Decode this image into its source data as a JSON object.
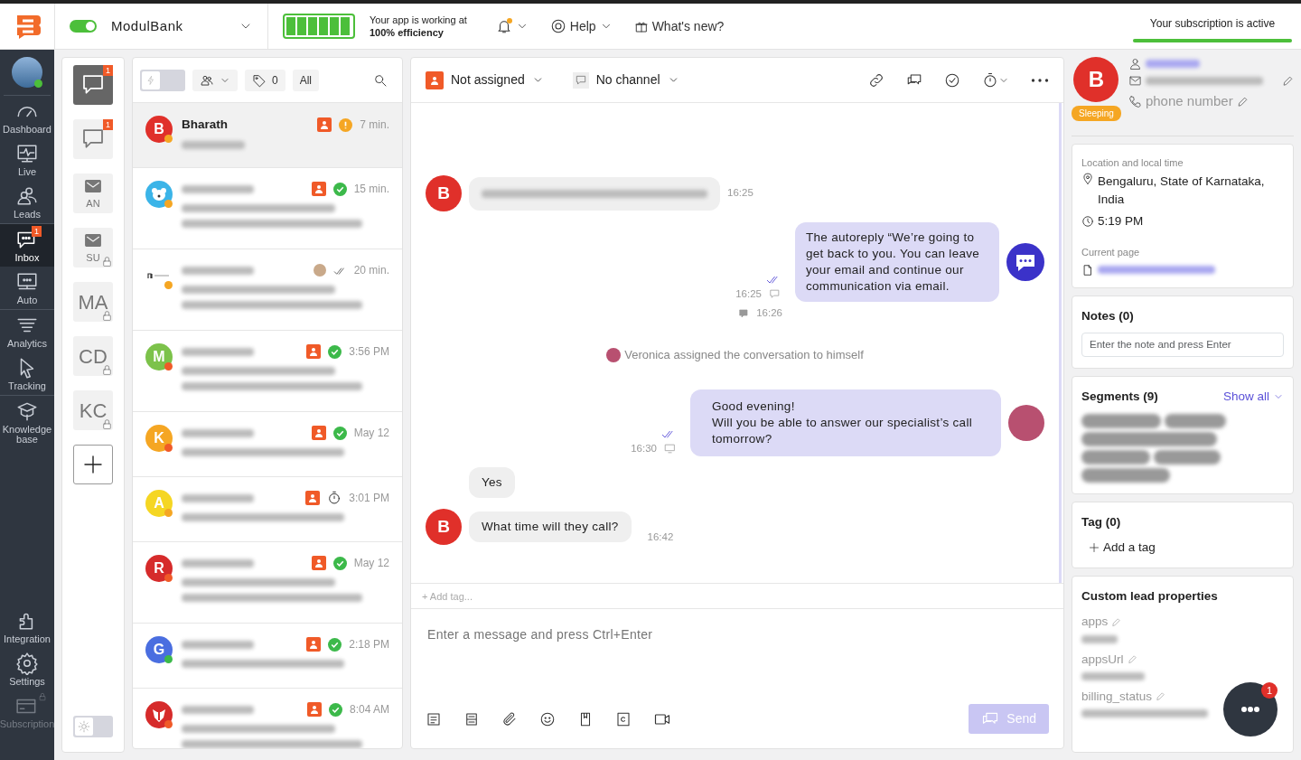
{
  "topbar": {
    "app_toggle_on": true,
    "project": "ModulBank",
    "battery": {
      "level": 1.0
    },
    "efficiency_line1": "Your app is working at",
    "efficiency_line2": "100% efficiency",
    "notifications_unread": true,
    "help": "Help",
    "whats_new": "What's new?",
    "subscription": {
      "text": "Your subscription is active",
      "level": 1.0
    }
  },
  "sidebar": {
    "items": [
      {
        "kind": "dashboard",
        "label": "Dashboard",
        "selected": false,
        "locked": false
      },
      {
        "kind": "live",
        "label": "Live",
        "selected": false,
        "locked": false
      },
      {
        "kind": "leads",
        "label": "Leads",
        "selected": false,
        "locked": false
      },
      {
        "kind": "inbox",
        "label": "Inbox",
        "selected": true,
        "badge": "1",
        "locked": false
      },
      {
        "kind": "auto",
        "label": "Auto",
        "selected": false,
        "locked": false
      },
      {
        "kind": "analytics",
        "label": "Analytics",
        "selected": false,
        "locked": false
      },
      {
        "kind": "tracking",
        "label": "Tracking",
        "selected": false,
        "locked": false
      },
      {
        "kind": "knowledge",
        "label": "Knowledge base",
        "selected": false,
        "locked": false
      },
      {
        "kind": "integration",
        "label": "Integration",
        "selected": false,
        "locked": false
      },
      {
        "kind": "settings",
        "label": "Settings",
        "selected": false,
        "locked": false
      },
      {
        "kind": "subscription",
        "label": "Subscription",
        "selected": false,
        "locked": true
      }
    ]
  },
  "channels": [
    {
      "kind": "chat",
      "selected": true,
      "badge": "1",
      "locked": false
    },
    {
      "kind": "chat",
      "selected": false,
      "badge": "1",
      "locked": false
    },
    {
      "kind": "mail",
      "label": "AN",
      "selected": false,
      "locked": false
    },
    {
      "kind": "mail",
      "label": "SU",
      "selected": false,
      "locked": true
    },
    {
      "kind": "text",
      "label": "MA",
      "selected": false,
      "locked": true
    },
    {
      "kind": "text",
      "label": "CD",
      "selected": false,
      "locked": true
    },
    {
      "kind": "text",
      "label": "KC",
      "selected": false,
      "locked": true
    }
  ],
  "theme_dark": false,
  "list_toolbar": {
    "auto_assign_on": false,
    "tag_count": "0",
    "filter": "All"
  },
  "conversations": [
    {
      "avatar": {
        "kind": "letter",
        "text": "B",
        "color": "#e0302a"
      },
      "dot": {
        "color": "#f5a623"
      },
      "status": {
        "kind": "pending"
      },
      "name": "Bharath",
      "time": "7 min.",
      "selected": true,
      "multiline_preview": false
    },
    {
      "avatar": {
        "kind": "bear",
        "color": "#3bb4e8"
      },
      "dot": {
        "color": "#f5a623"
      },
      "status": {
        "kind": "done"
      },
      "time": "15 min.",
      "selected": false,
      "multiline_preview": true
    },
    {
      "avatar": {
        "kind": "logo",
        "color": "#ffffff"
      },
      "dot": {
        "color": "#f5a623"
      },
      "status": {
        "kind": "read"
      },
      "time": "20 min.",
      "selected": false,
      "multiline_preview": true
    },
    {
      "avatar": {
        "kind": "letter",
        "text": "M",
        "color": "#7cc24a"
      },
      "dot": {
        "color": "#f05a28"
      },
      "status": {
        "kind": "done"
      },
      "time": "3:56 PM",
      "selected": false,
      "multiline_preview": true
    },
    {
      "avatar": {
        "kind": "letter",
        "text": "K",
        "color": "#f5a623"
      },
      "dot": {
        "color": "#f05a28"
      },
      "status": {
        "kind": "done"
      },
      "time": "May 12",
      "selected": false,
      "multiline_preview": false
    },
    {
      "avatar": {
        "kind": "letter",
        "text": "A",
        "color": "#f5d623"
      },
      "dot": {
        "color": "#f5a623"
      },
      "status": {
        "kind": "snoozed"
      },
      "time": "3:01 PM",
      "selected": false,
      "multiline_preview": false
    },
    {
      "avatar": {
        "kind": "letter",
        "text": "R",
        "color": "#d62b2b"
      },
      "dot": {
        "color": "#f05a28"
      },
      "status": {
        "kind": "done"
      },
      "time": "May 12",
      "selected": false,
      "multiline_preview": true
    },
    {
      "avatar": {
        "kind": "letter",
        "text": "G",
        "color": "#4a6ee0"
      },
      "dot": {
        "color": "#3cb94a"
      },
      "status": {
        "kind": "done"
      },
      "time": "2:18 PM",
      "selected": false,
      "multiline_preview": false
    },
    {
      "avatar": {
        "kind": "badger",
        "color": "#d62b2b"
      },
      "dot": {
        "color": "#f05a28"
      },
      "status": {
        "kind": "done"
      },
      "time": "8:04 AM",
      "selected": false,
      "multiline_preview": true
    }
  ],
  "chat_header": {
    "assignee": "Not assigned",
    "channel": "No channel"
  },
  "messages": [
    {
      "kind": "incoming",
      "avatar": "B",
      "time": "16:25"
    },
    {
      "kind": "outgoing",
      "text": "The autoreply “We’re going to get back to you. You can leave your email and continue our communication via email.",
      "time": "16:25",
      "bot": true,
      "read": true
    },
    {
      "kind": "note",
      "time": "16:26"
    },
    {
      "kind": "system",
      "text": "Veronica assigned the conversation to himself"
    },
    {
      "kind": "outgoing",
      "text": "Good evening!\nWill you be able to answer our specialist’s call tomorrow?",
      "time": "16:30",
      "bot": false,
      "read": true
    },
    {
      "kind": "incoming",
      "text": "Yes"
    },
    {
      "kind": "incoming",
      "avatar": "B",
      "text": "What time will they call?",
      "time": "16:42"
    }
  ],
  "composer": {
    "add_tag": "+ Add tag...",
    "placeholder": "Enter a message and press Ctrl+Enter",
    "send": "Send",
    "send_disabled": true
  },
  "lead": {
    "avatar": "B",
    "status": "Sleeping",
    "phone": "phone number",
    "location_label": "Location and local time",
    "location": "Bengaluru, State of Karnataka, India",
    "local_time": "5:19 PM",
    "page_label": "Current page",
    "notes_title": "Notes (0)",
    "notes_placeholder": "Enter the note and press Enter",
    "segments_title": "Segments (9)",
    "show_all": "Show all",
    "tag_title": "Tag (0)",
    "add_tag": "Add a tag",
    "props_title": "Custom lead properties",
    "props": [
      "apps",
      "appsUrl",
      "billing_status"
    ]
  },
  "chat_widget_badge": "1"
}
